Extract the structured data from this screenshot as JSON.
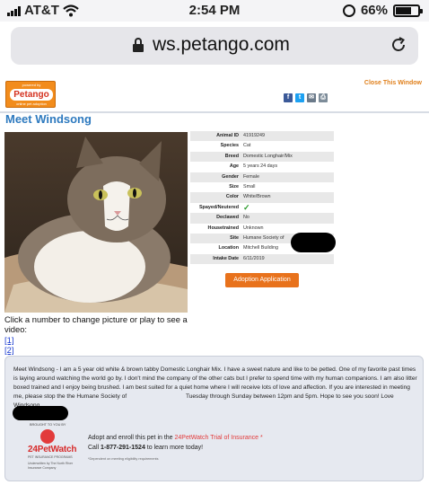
{
  "status_bar": {
    "carrier": "AT&T",
    "time": "2:54 PM",
    "battery_percent": "66%",
    "battery_level": 0.66
  },
  "browser": {
    "url": "ws.petango.com"
  },
  "header": {
    "logo": {
      "powered_by": "powered by",
      "brand": "Petango",
      "tagline": "online pet adoption"
    },
    "close_label": "Close This Window",
    "share_icons": [
      "facebook-icon",
      "twitter-icon",
      "email-icon",
      "print-icon"
    ]
  },
  "pet": {
    "title": "Meet Windsong",
    "details": [
      {
        "label": "Animal ID",
        "value": "41919249"
      },
      {
        "label": "Species",
        "value": "Cat"
      },
      {
        "label": "Breed",
        "value": "Domestic Longhair/Mix"
      },
      {
        "label": "Age",
        "value": "5 years 24 days"
      },
      {
        "label": "Gender",
        "value": "Female"
      },
      {
        "label": "Size",
        "value": "Small"
      },
      {
        "label": "Color",
        "value": "White/Brown"
      },
      {
        "label": "Spayed/Neutered",
        "value": "✓"
      },
      {
        "label": "Declawed",
        "value": "No"
      },
      {
        "label": "Housetrained",
        "value": "Unknown"
      },
      {
        "label": "Site",
        "value": "Humane Society of"
      },
      {
        "label": "Location",
        "value": "Mitchell Building"
      },
      {
        "label": "Intake Date",
        "value": "6/11/2019"
      }
    ],
    "adopt_button": "Adoption Application",
    "pictures_hint": "Click a number to change picture or play to see a video:",
    "picture_links": [
      "[1]",
      "[2]"
    ]
  },
  "description": {
    "text": "Meet Windsong - I am a 5 year old white & brown tabby Domestic Longhair Mix. I have a sweet nature and like to be petted. One of my favorite past times is laying around watching the world go by. I don't mind the company of the other cats but I prefer to spend time with my human companions. I am also litter boxed trained and I enjoy being brushed. I am best suited for a quiet home where I will receive lots of love and affection. If you are interested in meeting me, please stop the the Humane Society of",
    "text_tail": "Tuesday through Sunday between 12pm and 5pm. Hope to see you soon! Love Windsong"
  },
  "promo": {
    "brought_by": "BROUGHT TO YOU BY",
    "brand": "24PetWatch",
    "brand_sub": "PET INSURANCE PROGRAMS",
    "underwritten": "Underwritten by The North River Insurance Company",
    "line1_prefix": "Adopt and enroll this pet in the ",
    "line1_link": "24PetWatch Trial of Insurance *",
    "line2_prefix": "Call ",
    "phone": "1-877-291-1524",
    "line2_suffix": " to learn more today!",
    "footnote": "*Dependent on meeting eligibility requirements"
  },
  "colors": {
    "title_blue": "#2e7abf",
    "accent_orange": "#e8721c",
    "promo_red": "#e23b3b"
  }
}
